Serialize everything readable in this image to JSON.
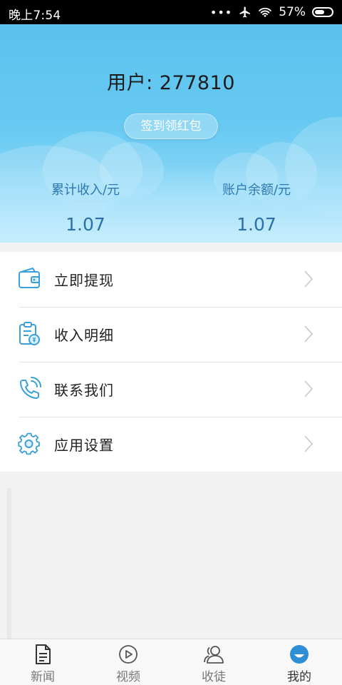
{
  "status_bar": {
    "time": "晚上7:54",
    "dots": "•••",
    "battery": "57%",
    "battery_level": 0.57
  },
  "header": {
    "user_title": "用户: 277810",
    "sign_button": "签到领红包",
    "stats": [
      {
        "label": "累计收入/元",
        "value": "1.07"
      },
      {
        "label": "账户余额/元",
        "value": "1.07"
      }
    ]
  },
  "menu": {
    "items": [
      {
        "label": "立即提现",
        "icon": "wallet-icon"
      },
      {
        "label": "收入明细",
        "icon": "clipboard-icon"
      },
      {
        "label": "联系我们",
        "icon": "phone-icon"
      },
      {
        "label": "应用设置",
        "icon": "gear-icon"
      }
    ]
  },
  "bottom_nav": {
    "items": [
      {
        "label": "新闻",
        "icon": "news-icon",
        "active": false
      },
      {
        "label": "视频",
        "icon": "video-play-icon",
        "active": false
      },
      {
        "label": "收徒",
        "icon": "users-icon",
        "active": false
      },
      {
        "label": "我的",
        "icon": "profile-icon",
        "active": true
      }
    ]
  },
  "colors": {
    "header_top": "#5bc2ee",
    "header_bottom": "#a5e0f9",
    "stat_text": "#2a6fa8",
    "icon_blue": "#3aa0d8",
    "nav_active": "#2f8fd6"
  }
}
